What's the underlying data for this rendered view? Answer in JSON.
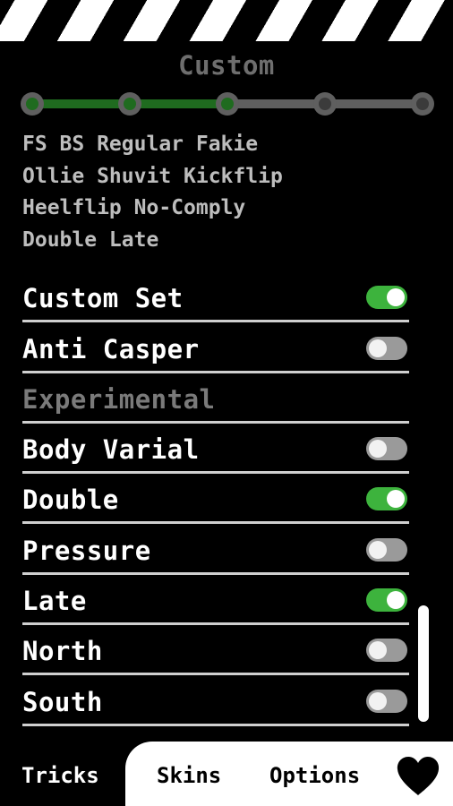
{
  "header": {
    "title": "Custom"
  },
  "stepper": {
    "total_steps": 5,
    "current_step": 3
  },
  "trick_summary": [
    "FS BS Regular Fakie",
    "Ollie Shuvit Kickflip",
    "Heelflip No-Comply",
    "Double Late"
  ],
  "settings": [
    {
      "label": "Custom Set",
      "on": true
    },
    {
      "label": "Anti Casper",
      "on": false
    },
    {
      "label": "Experimental",
      "header": true
    },
    {
      "label": "Body Varial",
      "on": false
    },
    {
      "label": "Double",
      "on": true
    },
    {
      "label": "Pressure",
      "on": false
    },
    {
      "label": "Late",
      "on": true
    },
    {
      "label": "North",
      "on": false
    },
    {
      "label": "South",
      "on": false
    }
  ],
  "tabs": {
    "tricks": "Tricks",
    "skins": "Skins",
    "options": "Options"
  },
  "icons": {
    "favorites": "heart-icon"
  },
  "colors": {
    "accent": "#3db33d",
    "progress": "#1f6b1f",
    "background": "#000000"
  }
}
